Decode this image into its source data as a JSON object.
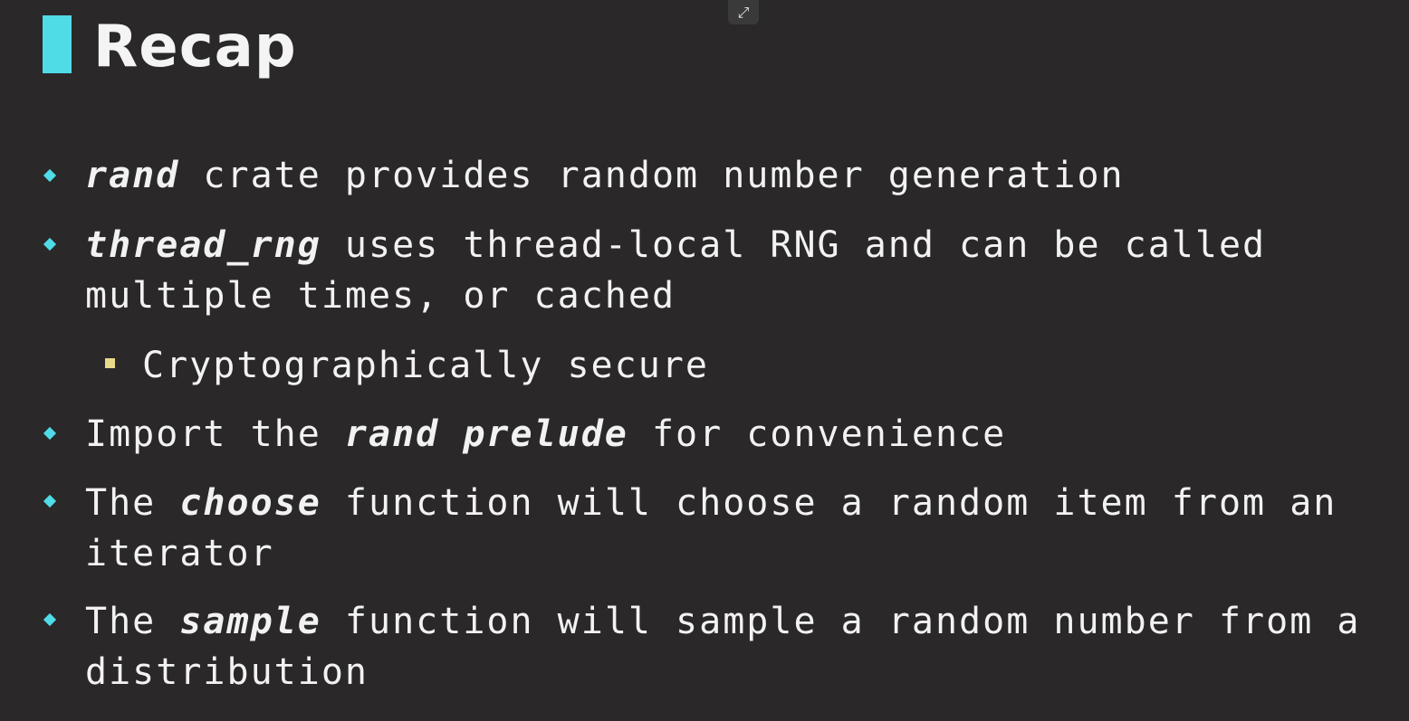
{
  "slide": {
    "title": "Recap",
    "exit_fullscreen_icon": "exit-fullscreen-icon",
    "bullets": [
      {
        "parts": [
          {
            "text": "rand",
            "emphasis": true
          },
          {
            "text": " crate provides random number generation",
            "emphasis": false
          }
        ]
      },
      {
        "parts": [
          {
            "text": "thread_rng",
            "emphasis": true
          },
          {
            "text": " uses thread-local RNG and can be called multiple times, or cached",
            "emphasis": false
          }
        ]
      },
      {
        "parts": [
          {
            "text": "Cryptographically secure",
            "emphasis": false
          }
        ]
      },
      {
        "parts": [
          {
            "text": "Import the ",
            "emphasis": false
          },
          {
            "text": "rand prelude",
            "emphasis": true
          },
          {
            "text": " for convenience",
            "emphasis": false
          }
        ]
      },
      {
        "parts": [
          {
            "text": "The ",
            "emphasis": false
          },
          {
            "text": "choose",
            "emphasis": true
          },
          {
            "text": " function will choose a random item from an iterator",
            "emphasis": false
          }
        ]
      },
      {
        "parts": [
          {
            "text": "The ",
            "emphasis": false
          },
          {
            "text": "sample",
            "emphasis": true
          },
          {
            "text": " function will sample a random number from a distribution",
            "emphasis": false
          }
        ]
      }
    ]
  },
  "colors": {
    "background": "#2a2829",
    "accent": "#4fdce6",
    "sub_bullet": "#e8d98a",
    "text": "#f2f2f2"
  }
}
